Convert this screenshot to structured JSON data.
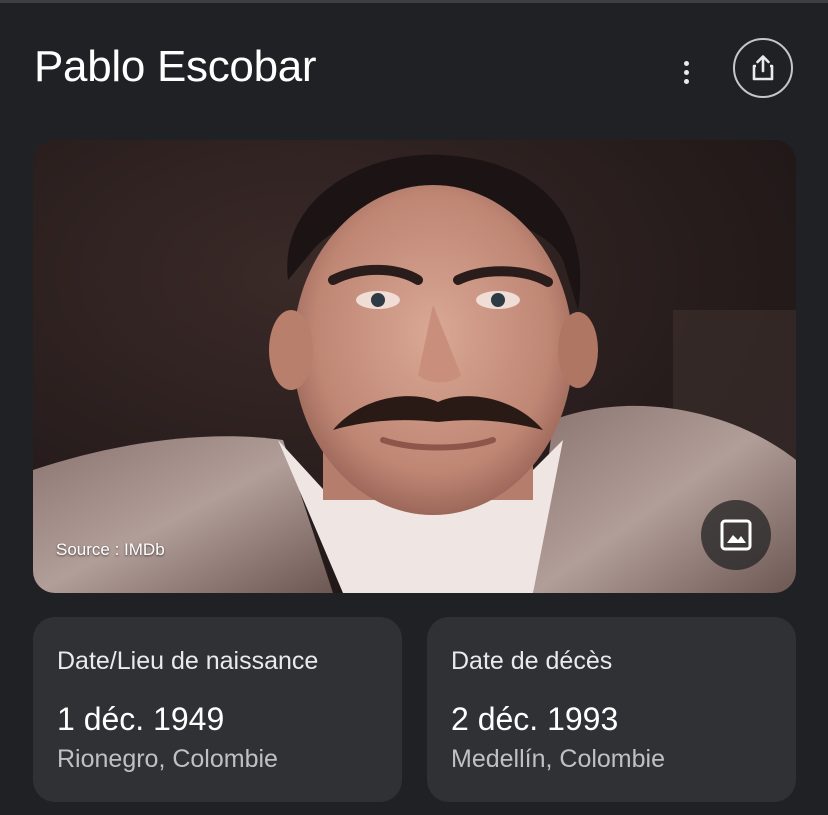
{
  "header": {
    "title": "Pablo Escobar",
    "menu_icon": "more-vertical-icon",
    "share_icon": "share-icon"
  },
  "image": {
    "source_caption": "Source : IMDb",
    "image_icon": "image-icon"
  },
  "facts": [
    {
      "label": "Date/Lieu de naissance",
      "date": "1 déc. 1949",
      "place": "Rionegro, Colombie"
    },
    {
      "label": "Date de décès",
      "date": "2 déc. 1993",
      "place": "Medellín, Colombie"
    }
  ],
  "colors": {
    "background": "#202124",
    "card": "#303134",
    "text_primary": "#ffffff",
    "text_secondary": "#bdc1c6"
  }
}
